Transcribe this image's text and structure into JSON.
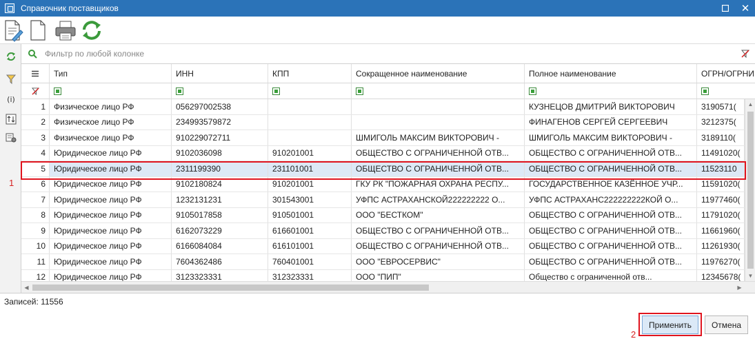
{
  "window": {
    "title": "Справочник поставщиков"
  },
  "filter": {
    "placeholder": "Фильтр по любой колонке"
  },
  "columns": [
    "Тип",
    "ИНН",
    "КПП",
    "Сокращенное наименование",
    "Полное наименование",
    "ОГРН/ОГРНИ"
  ],
  "rows": [
    {
      "n": "1",
      "type": "Физическое лицо РФ",
      "inn": "056297002538",
      "kpp": "",
      "short": "",
      "full": "КУЗНЕЦОВ ДМИТРИЙ ВИКТОРОВИЧ",
      "ogrn": "3190571("
    },
    {
      "n": "2",
      "type": "Физическое лицо РФ",
      "inn": "234993579872",
      "kpp": "",
      "short": "",
      "full": "ФИНАГЕНОВ СЕРГЕЙ СЕРГЕЕВИЧ",
      "ogrn": "3212375("
    },
    {
      "n": "3",
      "type": "Физическое лицо РФ",
      "inn": "910229072711",
      "kpp": "",
      "short": "ШМИГОЛЬ МАКСИМ ВИКТОРОВИЧ -",
      "full": "ШМИГОЛЬ МАКСИМ ВИКТОРОВИЧ -",
      "ogrn": "3189110("
    },
    {
      "n": "4",
      "type": "Юридическое лицо РФ",
      "inn": "9102036098",
      "kpp": "910201001",
      "short": "ОБЩЕСТВО С ОГРАНИЧЕННОЙ ОТВ...",
      "full": "ОБЩЕСТВО С ОГРАНИЧЕННОЙ ОТВ...",
      "ogrn": "11491020("
    },
    {
      "n": "5",
      "type": "Юридическое лицо РФ",
      "inn": "2311199390",
      "kpp": "231101001",
      "short": "ОБЩЕСТВО С ОГРАНИЧЕННОЙ ОТВ...",
      "full": "ОБЩЕСТВО С ОГРАНИЧЕННОЙ ОТВ...",
      "ogrn": "11523110"
    },
    {
      "n": "6",
      "type": "Юридическое лицо РФ",
      "inn": "9102180824",
      "kpp": "910201001",
      "short": "ГКУ РК \"ПОЖАРНАЯ ОХРАНА РЕСПУ...",
      "full": "ГОСУДАРСТВЕННОЕ КАЗЁННОЕ УЧР...",
      "ogrn": "11591020("
    },
    {
      "n": "7",
      "type": "Юридическое лицо РФ",
      "inn": "1232131231",
      "kpp": "301543001",
      "short": "УФПС АСТРАХАНСКОЙ222222222 О...",
      "full": "УФПС АСТРАХАНС222222222КОЙ О...",
      "ogrn": "11977460("
    },
    {
      "n": "8",
      "type": "Юридическое лицо РФ",
      "inn": "9105017858",
      "kpp": "910501001",
      "short": "ООО \"БЕСТКОМ\"",
      "full": "ОБЩЕСТВО С ОГРАНИЧЕННОЙ ОТВ...",
      "ogrn": "11791020("
    },
    {
      "n": "9",
      "type": "Юридическое лицо РФ",
      "inn": "6162073229",
      "kpp": "616601001",
      "short": "ОБЩЕСТВО С ОГРАНИЧЕННОЙ ОТВ...",
      "full": "ОБЩЕСТВО С ОГРАНИЧЕННОЙ ОТВ...",
      "ogrn": "11661960("
    },
    {
      "n": "10",
      "type": "Юридическое лицо РФ",
      "inn": "6166084084",
      "kpp": "616101001",
      "short": "ОБЩЕСТВО С ОГРАНИЧЕННОЙ ОТВ...",
      "full": "ОБЩЕСТВО С ОГРАНИЧЕННОЙ ОТВ...",
      "ogrn": "11261930("
    },
    {
      "n": "11",
      "type": "Юридическое лицо РФ",
      "inn": "7604362486",
      "kpp": "760401001",
      "short": "ООО \"ЕВРОСЕРВИС\"",
      "full": "ОБЩЕСТВО С ОГРАНИЧЕННОЙ ОТВ...",
      "ogrn": "11976270("
    },
    {
      "n": "12",
      "type": "Юридическое лицо РФ",
      "inn": "3123323331",
      "kpp": "312323331",
      "short": "ООО \"ПИП\"",
      "full": "Общество с ограниченной отв...",
      "ogrn": "12345678("
    }
  ],
  "selected_row": "5",
  "status": {
    "records": "Записей: 11556"
  },
  "buttons": {
    "apply": "Применить",
    "cancel": "Отмена"
  },
  "annotations": {
    "first": "1",
    "second": "2"
  },
  "colors": {
    "titlebar": "#2b73b8",
    "selection": "#dde9f6",
    "highlight": "#e0141e",
    "annotation": "#d62020",
    "checkbox": "#3aa03a"
  },
  "icons": {
    "toolbar": [
      "edit-document-icon",
      "new-document-icon",
      "print-icon",
      "refresh-icon"
    ],
    "sidebar": [
      "refresh-icon",
      "filter-icon",
      "info-icon",
      "sort-icon",
      "settings-icon"
    ]
  }
}
